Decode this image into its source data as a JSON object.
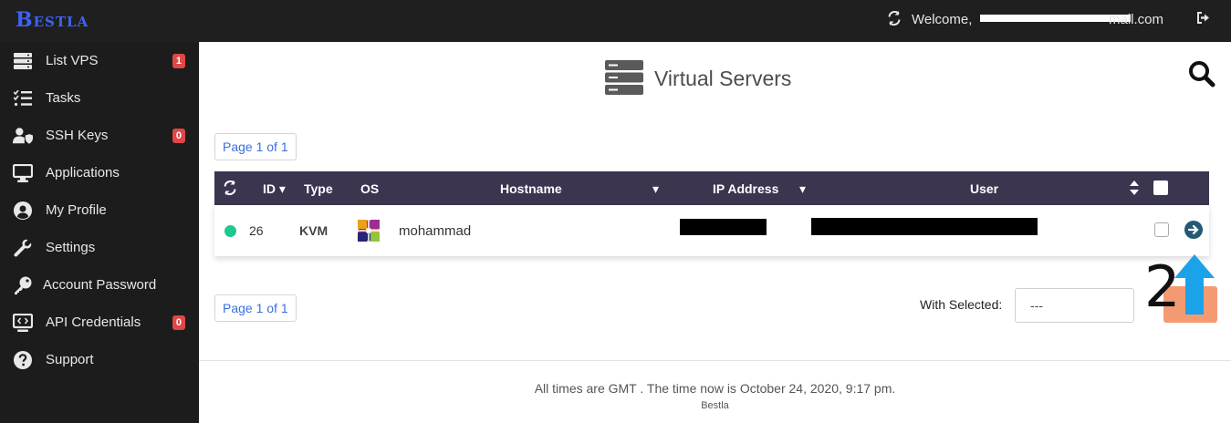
{
  "brand": "Bestla",
  "topbar": {
    "welcome_label": "Welcome,",
    "email_tail": "mail.com"
  },
  "sidebar": {
    "items": [
      {
        "label": "List VPS",
        "badge": "1",
        "icon": "server-stack-icon"
      },
      {
        "label": "Tasks",
        "badge": "",
        "icon": "task-list-icon"
      },
      {
        "label": "SSH Keys",
        "badge": "0",
        "icon": "user-shield-icon"
      },
      {
        "label": "Applications",
        "badge": "",
        "icon": "desktop-icon"
      },
      {
        "label": "My Profile",
        "badge": "",
        "icon": "user-circle-icon"
      },
      {
        "label": "Settings",
        "badge": "",
        "icon": "wrench-icon"
      },
      {
        "label": "Account Password",
        "badge": "",
        "icon": "key-icon"
      },
      {
        "label": "API Credentials",
        "badge": "0",
        "icon": "code-monitor-icon"
      },
      {
        "label": "Support",
        "badge": "",
        "icon": "question-circle-icon"
      }
    ]
  },
  "main": {
    "title": "Virtual Servers",
    "pager_top": "Page 1 of 1",
    "pager_bottom": "Page 1 of 1",
    "table": {
      "columns": [
        "ID",
        "Type",
        "OS",
        "Hostname",
        "IP Address",
        "User"
      ],
      "rows": [
        {
          "id": "26",
          "type": "KVM",
          "os_icon": "centos-logo-icon",
          "hostname": "mohammad",
          "status": "online"
        }
      ]
    },
    "with_selected_label": "With Selected:",
    "with_selected_value": "---",
    "annotation": "2"
  },
  "footer": {
    "text": "All times are GMT . The time now is October 24, 2020, 9:17 pm.",
    "brand": "Bestla"
  },
  "colors": {
    "topbar_bg": "#1f1f1f",
    "sidebar_bg": "#1c1c1c",
    "table_head_bg": "#3b3550",
    "brand": "#3d63f0",
    "badge": "#e04747",
    "status_online": "#1fc98e",
    "submit": "#f49a72",
    "annotation_arrow": "#1aa3e8"
  }
}
